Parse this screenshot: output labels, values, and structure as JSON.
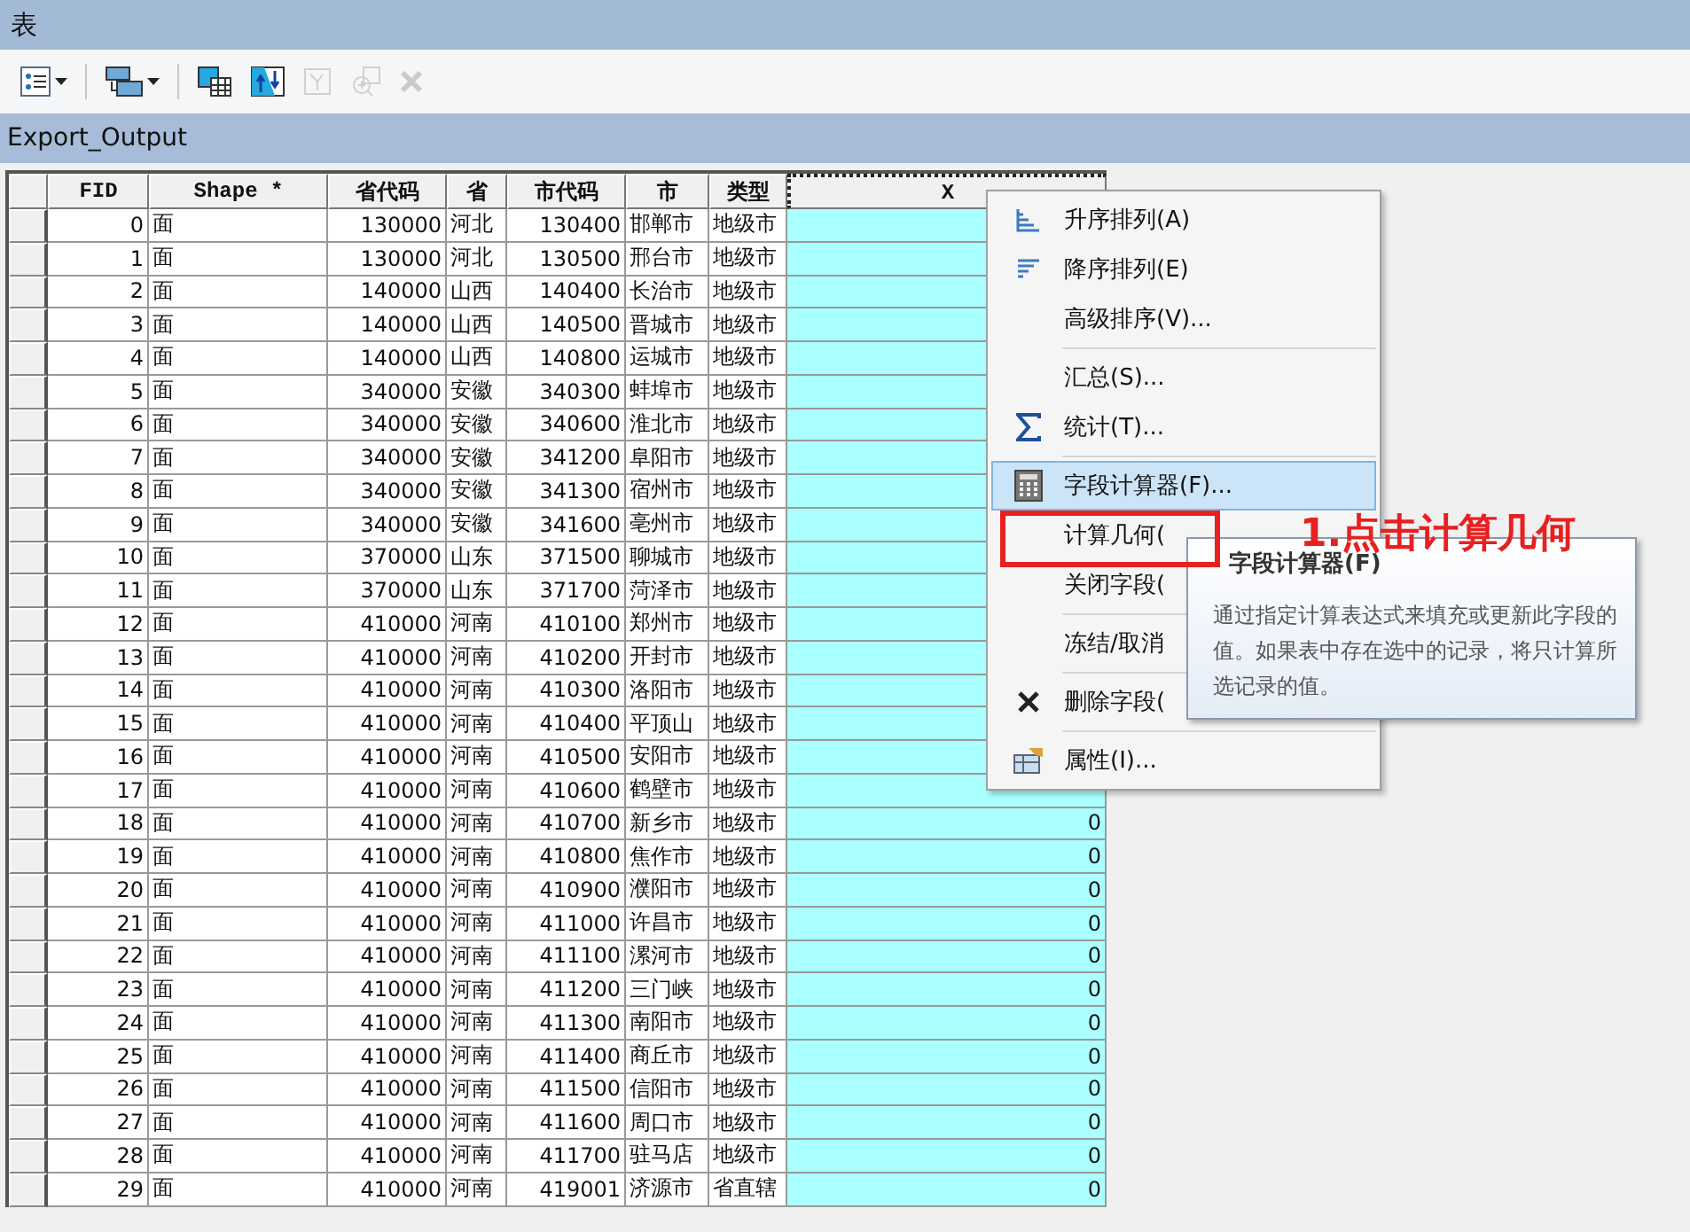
{
  "window": {
    "title": "表"
  },
  "toolbar": [
    {
      "kind": "list",
      "dropdown": true,
      "disabled": false
    },
    {
      "kind": "related",
      "dropdown": true,
      "disabled": false
    },
    {
      "kind": "select",
      "dropdown": false,
      "disabled": false
    },
    {
      "kind": "switch",
      "dropdown": false,
      "disabled": false
    },
    {
      "kind": "clear",
      "dropdown": false,
      "disabled": true
    },
    {
      "kind": "zoom",
      "dropdown": false,
      "disabled": true
    },
    {
      "kind": "delete",
      "dropdown": false,
      "disabled": true
    }
  ],
  "table_tab": "Export_Output",
  "table": {
    "columns": [
      {
        "label": "FID",
        "kind": "number",
        "selected": false
      },
      {
        "label": "Shape *",
        "kind": "text",
        "selected": false
      },
      {
        "label": "省代码",
        "kind": "number",
        "selected": false
      },
      {
        "label": "省",
        "kind": "text",
        "selected": false
      },
      {
        "label": "市代码",
        "kind": "number",
        "selected": false
      },
      {
        "label": "市",
        "kind": "text",
        "selected": false
      },
      {
        "label": "类型",
        "kind": "text",
        "selected": false
      },
      {
        "label": "X",
        "kind": "number",
        "selected": true
      }
    ],
    "rows": [
      [
        "0",
        "面",
        "130000",
        "河北",
        "130400",
        "邯郸市",
        "地级市"
      ],
      [
        "1",
        "面",
        "130000",
        "河北",
        "130500",
        "邢台市",
        "地级市"
      ],
      [
        "2",
        "面",
        "140000",
        "山西",
        "140400",
        "长治市",
        "地级市"
      ],
      [
        "3",
        "面",
        "140000",
        "山西",
        "140500",
        "晋城市",
        "地级市"
      ],
      [
        "4",
        "面",
        "140000",
        "山西",
        "140800",
        "运城市",
        "地级市"
      ],
      [
        "5",
        "面",
        "340000",
        "安徽",
        "340300",
        "蚌埠市",
        "地级市"
      ],
      [
        "6",
        "面",
        "340000",
        "安徽",
        "340600",
        "淮北市",
        "地级市"
      ],
      [
        "7",
        "面",
        "340000",
        "安徽",
        "341200",
        "阜阳市",
        "地级市"
      ],
      [
        "8",
        "面",
        "340000",
        "安徽",
        "341300",
        "宿州市",
        "地级市"
      ],
      [
        "9",
        "面",
        "340000",
        "安徽",
        "341600",
        "亳州市",
        "地级市"
      ],
      [
        "10",
        "面",
        "370000",
        "山东",
        "371500",
        "聊城市",
        "地级市"
      ],
      [
        "11",
        "面",
        "370000",
        "山东",
        "371700",
        "菏泽市",
        "地级市"
      ],
      [
        "12",
        "面",
        "410000",
        "河南",
        "410100",
        "郑州市",
        "地级市"
      ],
      [
        "13",
        "面",
        "410000",
        "河南",
        "410200",
        "开封市",
        "地级市"
      ],
      [
        "14",
        "面",
        "410000",
        "河南",
        "410300",
        "洛阳市",
        "地级市"
      ],
      [
        "15",
        "面",
        "410000",
        "河南",
        "410400",
        "平顶山",
        "地级市"
      ],
      [
        "16",
        "面",
        "410000",
        "河南",
        "410500",
        "安阳市",
        "地级市"
      ],
      [
        "17",
        "面",
        "410000",
        "河南",
        "410600",
        "鹤壁市",
        "地级市"
      ],
      [
        "18",
        "面",
        "410000",
        "河南",
        "410700",
        "新乡市",
        "地级市",
        "0"
      ],
      [
        "19",
        "面",
        "410000",
        "河南",
        "410800",
        "焦作市",
        "地级市",
        "0"
      ],
      [
        "20",
        "面",
        "410000",
        "河南",
        "410900",
        "濮阳市",
        "地级市",
        "0"
      ],
      [
        "21",
        "面",
        "410000",
        "河南",
        "411000",
        "许昌市",
        "地级市",
        "0"
      ],
      [
        "22",
        "面",
        "410000",
        "河南",
        "411100",
        "漯河市",
        "地级市",
        "0"
      ],
      [
        "23",
        "面",
        "410000",
        "河南",
        "411200",
        "三门峡",
        "地级市",
        "0"
      ],
      [
        "24",
        "面",
        "410000",
        "河南",
        "411300",
        "南阳市",
        "地级市",
        "0"
      ],
      [
        "25",
        "面",
        "410000",
        "河南",
        "411400",
        "商丘市",
        "地级市",
        "0"
      ],
      [
        "26",
        "面",
        "410000",
        "河南",
        "411500",
        "信阳市",
        "地级市",
        "0"
      ],
      [
        "27",
        "面",
        "410000",
        "河南",
        "411600",
        "周口市",
        "地级市",
        "0"
      ],
      [
        "28",
        "面",
        "410000",
        "河南",
        "411700",
        "驻马店",
        "地级市",
        "0"
      ],
      [
        "29",
        "面",
        "410000",
        "河南",
        "419001",
        "济源市",
        "省直辖",
        "0"
      ]
    ]
  },
  "context_menu": {
    "groups": [
      [
        {
          "label": "升序排列(A)",
          "kind": "sort-asc",
          "selected": false
        },
        {
          "label": "降序排列(E)",
          "kind": "sort-desc",
          "selected": false
        },
        {
          "label": "高级排序(V)...",
          "kind": "none",
          "selected": false
        }
      ],
      [
        {
          "label": "汇总(S)...",
          "kind": "none",
          "selected": false
        },
        {
          "label": "统计(T)...",
          "kind": "sigma",
          "selected": false
        }
      ],
      [
        {
          "label": "字段计算器(F)...",
          "kind": "calculator",
          "selected": true
        },
        {
          "label": "计算几何(",
          "kind": "none",
          "selected": false
        },
        {
          "label": "关闭字段(",
          "kind": "none",
          "selected": false
        }
      ],
      [
        {
          "label": "冻结/取消",
          "kind": "none",
          "selected": false
        }
      ],
      [
        {
          "label": "删除字段(",
          "kind": "delete",
          "selected": false
        }
      ],
      [
        {
          "label": "属性(I)...",
          "kind": "properties",
          "selected": false
        }
      ]
    ]
  },
  "tooltip": {
    "title": "字段计算器(F)",
    "text": "通过指定计算表达式来填充或更新此字段的值。如果表中存在选中的记录，将只计算所选记录的值。"
  },
  "annotation": {
    "text": "1.点击计算几何"
  }
}
